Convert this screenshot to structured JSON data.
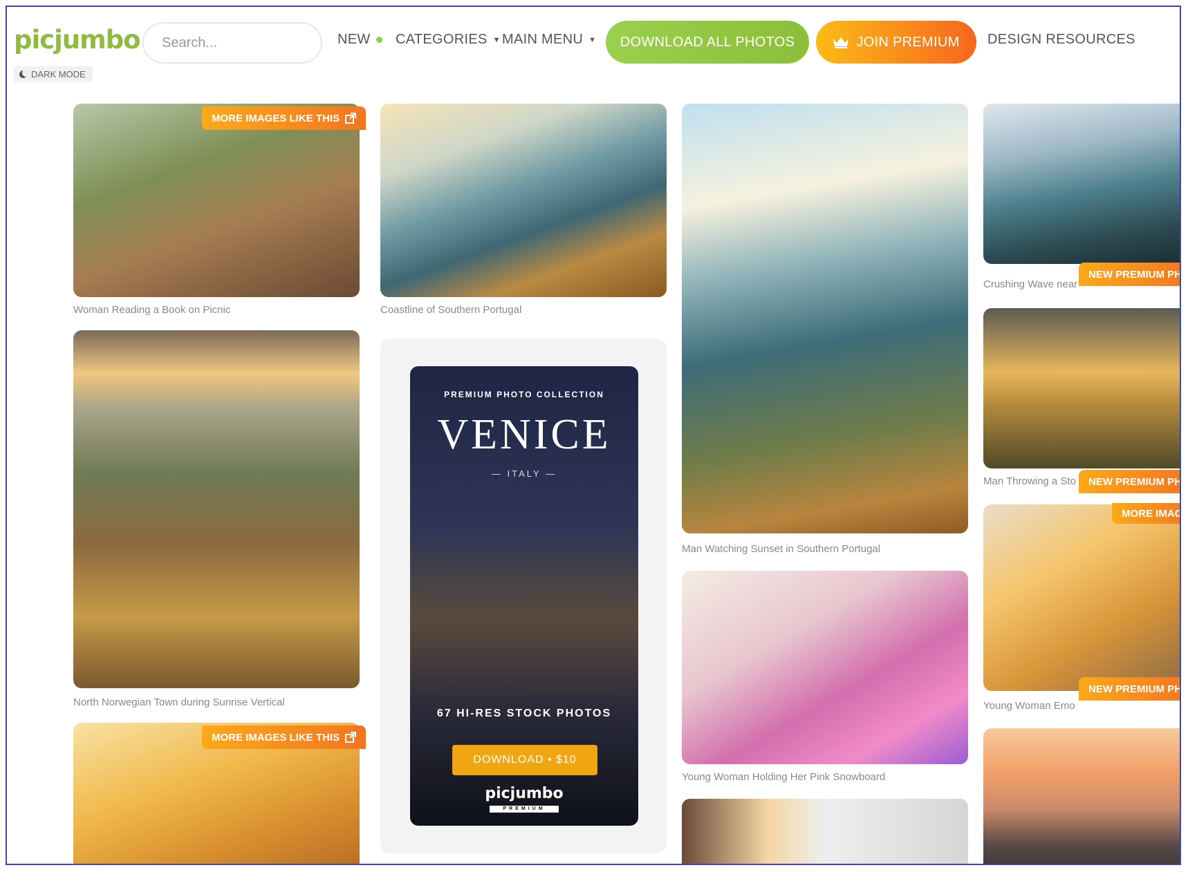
{
  "header": {
    "logo": "picjumbo",
    "dark_mode_label": "DARK MODE",
    "search": {
      "placeholder": "Search..."
    },
    "nav": {
      "new": "NEW",
      "categories": "CATEGORIES",
      "main_menu": "MAIN MENU",
      "download_all": "DOWNLOAD ALL PHOTOS",
      "join_premium": "JOIN PREMIUM",
      "design_resources": "DESIGN RESOURCES"
    }
  },
  "badges": {
    "more_images": "MORE IMAGES LIKE THIS",
    "new_premium": "NEW PREMIUM PH",
    "more_image_short": "MORE IMAGE"
  },
  "photos": {
    "c1": [
      {
        "caption": "Woman Reading a Book on Picnic"
      },
      {
        "caption": "North Norwegian Town during Sunrise Vertical"
      },
      {
        "caption": ""
      }
    ],
    "c2": [
      {
        "caption": "Coastline of Southern Portugal"
      }
    ],
    "c3": [
      {
        "caption": "Man Watching Sunset in Southern Portugal"
      },
      {
        "caption": "Young Woman Holding Her Pink Snowboard"
      },
      {
        "caption": ""
      }
    ],
    "c4": [
      {
        "caption": "Crushing Wave near"
      },
      {
        "caption": "Man Throwing a Sto"
      },
      {
        "caption": "Young Woman Emo"
      },
      {
        "caption": ""
      }
    ]
  },
  "promo": {
    "eyebrow": "PREMIUM PHOTO COLLECTION",
    "title": "VENICE",
    "subtitle": "— ITALY —",
    "count": "67 HI-RES STOCK PHOTOS",
    "button": "DOWNLOAD • $10",
    "brand": "picjumbo",
    "brand_sub": "PREMIUM"
  },
  "colors": {
    "brand_green": "#8fbc3f",
    "premium_orange": "#f6661f",
    "badge_orange": "#fba91b",
    "frame_border": "#3e46a8"
  }
}
